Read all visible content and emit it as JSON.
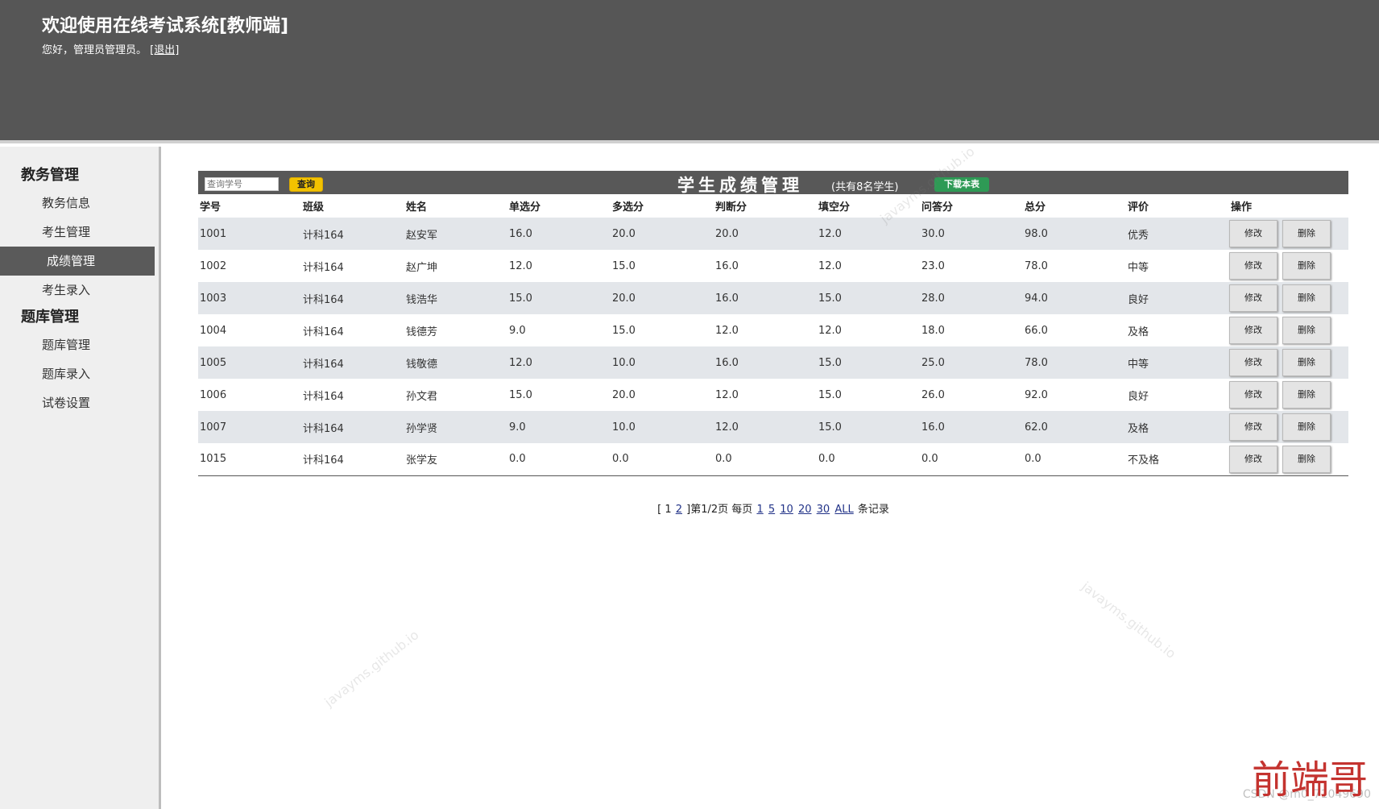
{
  "header": {
    "title": "欢迎使用在线考试系统[教师端]",
    "greeting": "您好，管理员管理员。",
    "logout": "[退出]"
  },
  "sidebar": {
    "groups": [
      {
        "label": "教务管理",
        "items": [
          "教务信息",
          "考生管理",
          "成绩管理",
          "考生录入"
        ]
      },
      {
        "label": "题库管理",
        "items": [
          "题库管理",
          "题库录入",
          "试卷设置"
        ]
      }
    ],
    "active": "成绩管理"
  },
  "toolbar": {
    "search_placeholder": "查询学号",
    "search_button": "查询",
    "heading": "学生成绩管理",
    "count": "(共有8名学生)",
    "download_button": "下载本表"
  },
  "table": {
    "columns": [
      "学号",
      "班级",
      "姓名",
      "单选分",
      "多选分",
      "判断分",
      "填空分",
      "问答分",
      "总分",
      "评价",
      "操作"
    ],
    "rows": [
      [
        "1001",
        "计科164",
        "赵安军",
        "16.0",
        "20.0",
        "20.0",
        "12.0",
        "30.0",
        "98.0",
        "优秀"
      ],
      [
        "1002",
        "计科164",
        "赵广坤",
        "12.0",
        "15.0",
        "16.0",
        "12.0",
        "23.0",
        "78.0",
        "中等"
      ],
      [
        "1003",
        "计科164",
        "钱浩华",
        "15.0",
        "20.0",
        "16.0",
        "15.0",
        "28.0",
        "94.0",
        "良好"
      ],
      [
        "1004",
        "计科164",
        "钱德芳",
        "9.0",
        "15.0",
        "12.0",
        "12.0",
        "18.0",
        "66.0",
        "及格"
      ],
      [
        "1005",
        "计科164",
        "钱敬德",
        "12.0",
        "10.0",
        "16.0",
        "15.0",
        "25.0",
        "78.0",
        "中等"
      ],
      [
        "1006",
        "计科164",
        "孙文君",
        "15.0",
        "20.0",
        "12.0",
        "15.0",
        "26.0",
        "92.0",
        "良好"
      ],
      [
        "1007",
        "计科164",
        "孙学贤",
        "9.0",
        "10.0",
        "12.0",
        "15.0",
        "16.0",
        "62.0",
        "及格"
      ],
      [
        "1015",
        "计科164",
        "张学友",
        "0.0",
        "0.0",
        "0.0",
        "0.0",
        "0.0",
        "0.0",
        "不及格"
      ]
    ],
    "edit_label": "修改",
    "delete_label": "删除"
  },
  "pager": {
    "prefix": "[ 1",
    "page2": "2",
    "middle": "]第1/2页 每页",
    "sizes": [
      "1",
      "5",
      "10",
      "20",
      "30",
      "ALL"
    ],
    "suffix": "条记录"
  },
  "watermark": "javayms.github.io",
  "brand": "前端哥",
  "credit": "CSDN @m0_71049690"
}
